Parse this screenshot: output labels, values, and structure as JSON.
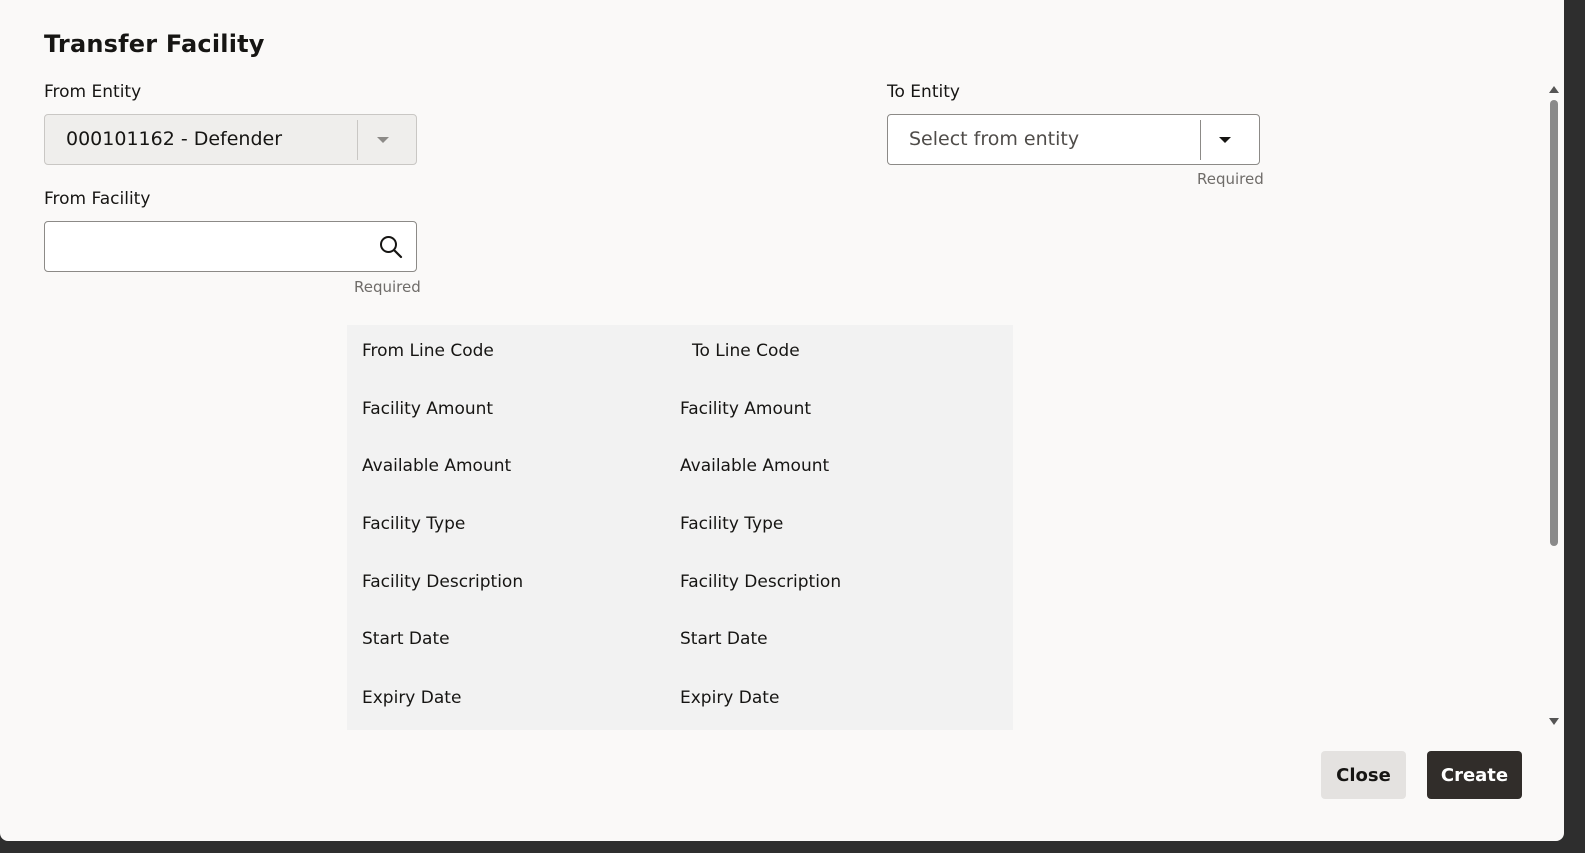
{
  "dialog": {
    "title": "Transfer Facility",
    "close_label": "Close",
    "create_label": "Create"
  },
  "from_entity": {
    "label": "From Entity",
    "value": "000101162 - Defender"
  },
  "to_entity": {
    "label": "To Entity",
    "placeholder": "Select from entity",
    "required_text": "Required"
  },
  "from_facility": {
    "label": "From Facility",
    "value": "",
    "required_text": "Required"
  },
  "comparison": {
    "rows": [
      {
        "left": "From Line Code",
        "right": "To Line Code"
      },
      {
        "left": "Facility Amount",
        "right": "Facility Amount"
      },
      {
        "left": "Available Amount",
        "right": "Available Amount"
      },
      {
        "left": "Facility Type",
        "right": "Facility Type"
      },
      {
        "left": "Facility Description",
        "right": "Facility Description"
      },
      {
        "left": "Start Date",
        "right": "Start Date"
      },
      {
        "left": "Expiry Date",
        "right": "Expiry Date"
      }
    ]
  },
  "icons": {
    "search": "search-icon",
    "dropdown": "chevron-down-icon"
  }
}
